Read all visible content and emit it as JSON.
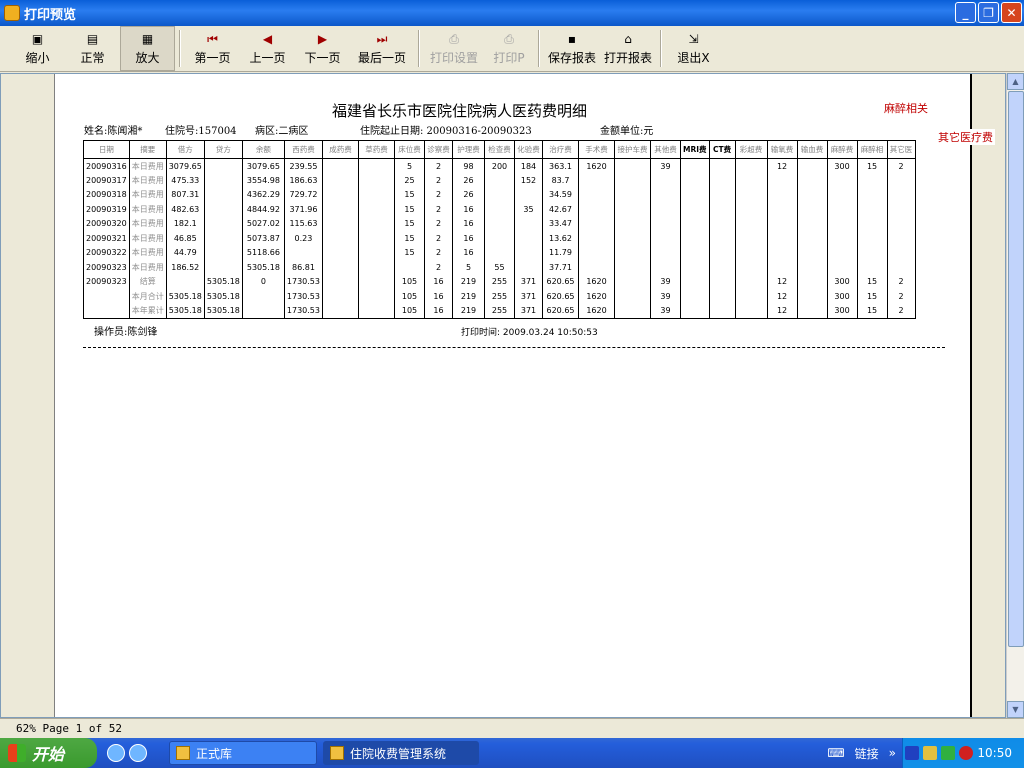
{
  "window": {
    "title": "打印预览"
  },
  "toolbar": {
    "buttons": [
      {
        "label": "缩小",
        "icon": "zoom-out-icon"
      },
      {
        "label": "正常",
        "icon": "page-normal-icon"
      },
      {
        "label": "放大",
        "icon": "zoom-in-icon"
      },
      {
        "label": "第一页",
        "icon": "first-page-icon"
      },
      {
        "label": "上一页",
        "icon": "prev-page-icon"
      },
      {
        "label": "下一页",
        "icon": "next-page-icon"
      },
      {
        "label": "最后一页",
        "icon": "last-page-icon"
      },
      {
        "label": "打印设置",
        "icon": "printer-settings-icon"
      },
      {
        "label": "打印P",
        "icon": "printer-icon"
      },
      {
        "label": "保存报表",
        "icon": "save-icon"
      },
      {
        "label": "打开报表",
        "icon": "open-folder-icon"
      },
      {
        "label": "退出X",
        "icon": "exit-icon"
      }
    ]
  },
  "report": {
    "title": "福建省长乐市医院住院病人医药费明细",
    "red_label_1": "麻醉相关",
    "red_label_2": "其它医疗费",
    "patient_name": "姓名:陈闻湘*",
    "admission_no": "住院号:157004",
    "ward": "病区:二病区",
    "date_range": "住院起止日期: 20090316-20090323",
    "unit": "金额单位:元",
    "columns": [
      "日期",
      "摘要",
      "借方",
      "贷方",
      "余额",
      "西药费",
      "成药费",
      "草药费",
      "床位费",
      "诊察费",
      "护理费",
      "检查费",
      "化验费",
      "治疗费",
      "手术费",
      "接护车费",
      "其他费",
      "MRI费",
      "CT费",
      "彩超费",
      "输氧费",
      "输血费",
      "麻醉费",
      "麻醉相",
      "其它医"
    ],
    "rows": [
      [
        "20090316",
        "本日费用",
        "3079.65",
        "",
        "3079.65",
        "239.55",
        "",
        "",
        "5",
        "2",
        "98",
        "200",
        "184",
        "363.1",
        "1620",
        "",
        "39",
        "",
        "",
        "",
        "12",
        "",
        "300",
        "15",
        "2"
      ],
      [
        "20090317",
        "本日费用",
        "475.33",
        "",
        "3554.98",
        "186.63",
        "",
        "",
        "25",
        "2",
        "26",
        "",
        "152",
        "83.7",
        "",
        "",
        "",
        "",
        "",
        "",
        "",
        "",
        "",
        "",
        ""
      ],
      [
        "20090318",
        "本日费用",
        "807.31",
        "",
        "4362.29",
        "729.72",
        "",
        "",
        "15",
        "2",
        "26",
        "",
        "",
        "34.59",
        "",
        "",
        "",
        "",
        "",
        "",
        "",
        "",
        "",
        "",
        ""
      ],
      [
        "20090319",
        "本日费用",
        "482.63",
        "",
        "4844.92",
        "371.96",
        "",
        "",
        "15",
        "2",
        "16",
        "",
        "35",
        "42.67",
        "",
        "",
        "",
        "",
        "",
        "",
        "",
        "",
        "",
        "",
        ""
      ],
      [
        "20090320",
        "本日费用",
        "182.1",
        "",
        "5027.02",
        "115.63",
        "",
        "",
        "15",
        "2",
        "16",
        "",
        "",
        "33.47",
        "",
        "",
        "",
        "",
        "",
        "",
        "",
        "",
        "",
        "",
        ""
      ],
      [
        "20090321",
        "本日费用",
        "46.85",
        "",
        "5073.87",
        "0.23",
        "",
        "",
        "15",
        "2",
        "16",
        "",
        "",
        "13.62",
        "",
        "",
        "",
        "",
        "",
        "",
        "",
        "",
        "",
        "",
        ""
      ],
      [
        "20090322",
        "本日费用",
        "44.79",
        "",
        "5118.66",
        "",
        "",
        "",
        "15",
        "2",
        "16",
        "",
        "",
        "11.79",
        "",
        "",
        "",
        "",
        "",
        "",
        "",
        "",
        "",
        "",
        ""
      ],
      [
        "20090323",
        "本日费用",
        "186.52",
        "",
        "5305.18",
        "86.81",
        "",
        "",
        "",
        "2",
        "5",
        "55",
        "",
        "37.71",
        "",
        "",
        "",
        "",
        "",
        "",
        "",
        "",
        "",
        "",
        ""
      ],
      [
        "20090323",
        "结算",
        "",
        "5305.18",
        "0",
        "1730.53",
        "",
        "",
        "105",
        "16",
        "219",
        "255",
        "371",
        "620.65",
        "1620",
        "",
        "39",
        "",
        "",
        "",
        "12",
        "",
        "300",
        "15",
        "2"
      ],
      [
        "",
        "本月合计",
        "5305.18",
        "5305.18",
        "",
        "1730.53",
        "",
        "",
        "105",
        "16",
        "219",
        "255",
        "371",
        "620.65",
        "1620",
        "",
        "39",
        "",
        "",
        "",
        "12",
        "",
        "300",
        "15",
        "2"
      ],
      [
        "",
        "本年累计",
        "5305.18",
        "5305.18",
        "",
        "1730.53",
        "",
        "",
        "105",
        "16",
        "219",
        "255",
        "371",
        "620.65",
        "1620",
        "",
        "39",
        "",
        "",
        "",
        "12",
        "",
        "300",
        "15",
        "2"
      ]
    ],
    "operator": "操作员:陈剑锋",
    "print_time": "打印时间: 2009.03.24 10:50:53"
  },
  "statusbar": {
    "text": "62% Page 1 of 52"
  },
  "taskbar": {
    "start_label": "开始",
    "tasks": [
      {
        "label": "正式库",
        "active": false
      },
      {
        "label": "住院收费管理系统",
        "active": true
      }
    ],
    "links_label": "链接",
    "clock": "10:50"
  },
  "colors": {
    "accent_red": "#c00000",
    "titlebar": "#0a5fd8",
    "taskbar": "#245edb"
  }
}
